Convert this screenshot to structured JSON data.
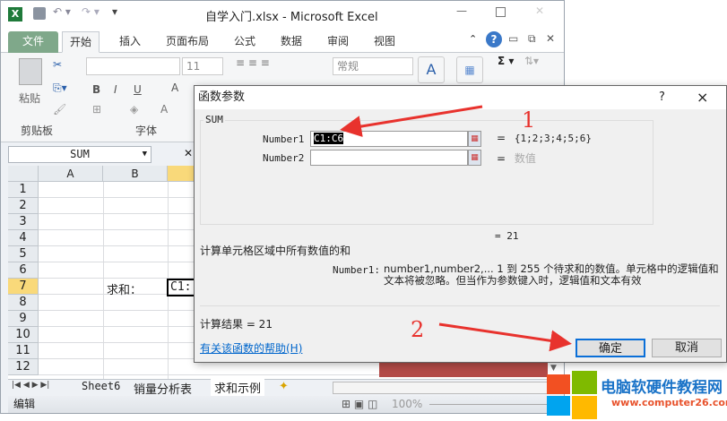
{
  "window": {
    "title": "自学入门.xlsx  -  Microsoft Excel"
  },
  "ribbon_tabs": [
    "文件",
    "开始",
    "插入",
    "页面布局",
    "公式",
    "数据",
    "审阅",
    "视图"
  ],
  "ribbon": {
    "font_size": "11",
    "number_format": "常规",
    "groups": [
      "剪贴板",
      "字体"
    ],
    "paste_label": "粘贴"
  },
  "formula_bar": {
    "name_box": "SUM"
  },
  "grid": {
    "columns": [
      "A",
      "B"
    ],
    "rows": [
      "1",
      "2",
      "3",
      "4",
      "5",
      "6",
      "7",
      "8",
      "9",
      "10",
      "11",
      "12"
    ],
    "b7": "求和：",
    "c7": "C1:"
  },
  "sheets": [
    "Sheet6",
    "销量分析表",
    "求和示例"
  ],
  "status": {
    "mode": "编辑",
    "zoom": "100%"
  },
  "dialog": {
    "title": "函数参数",
    "help": "?",
    "close": "×",
    "function": "SUM",
    "args": [
      {
        "label": "Number1",
        "value": "C1:C6",
        "result": "{1;2;3;4;5;6}"
      },
      {
        "label": "Number2",
        "value": "",
        "result": "数值"
      }
    ],
    "total": "= 21",
    "description": "计算单元格区域中所有数值的和",
    "arg_help_label": "Number1:",
    "arg_help": "number1,number2,...  1 到 255 个待求和的数值。单元格中的逻辑值和文本将被忽略。但当作为参数键入时，逻辑值和文本有效",
    "result_label": "计算结果 = 21",
    "help_link": "有关该函数的帮助(H)",
    "ok": "确定",
    "cancel": "取消"
  },
  "annotations": {
    "step1": "1",
    "step2": "2"
  },
  "watermark": {
    "name": "电脑软硬件教程网",
    "url": "www.computer26.com"
  }
}
